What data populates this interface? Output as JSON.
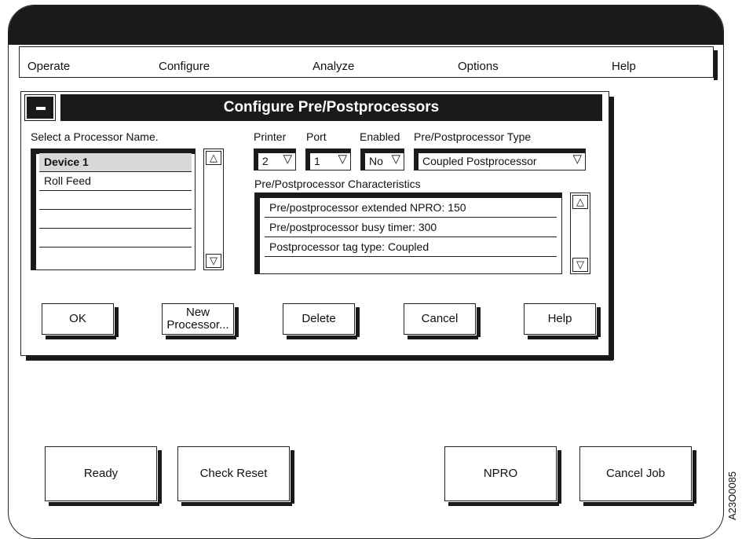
{
  "menubar": {
    "items": [
      "Operate",
      "Configure",
      "Analyze",
      "Options",
      "Help"
    ]
  },
  "dialog": {
    "title": "Configure Pre/Postprocessors",
    "processor_list": {
      "label": "Select a Processor Name.",
      "items": [
        "Device 1",
        "Roll Feed",
        "",
        "",
        "",
        ""
      ],
      "selected": "Device 1"
    },
    "printer": {
      "label": "Printer",
      "value": "2"
    },
    "port": {
      "label": "Port",
      "value": "1"
    },
    "enabled": {
      "label": "Enabled",
      "value": "No"
    },
    "type": {
      "label": "Pre/Postprocessor Type",
      "value": "Coupled Postprocessor"
    },
    "characteristics": {
      "label": "Pre/Postprocessor Characteristics",
      "items": [
        "Pre/postprocessor extended NPRO: 150",
        "Pre/postprocessor busy timer: 300",
        "Postprocessor tag type: Coupled",
        ""
      ]
    },
    "buttons": {
      "ok": "OK",
      "new_processor_line1": "New",
      "new_processor_line2": "Processor...",
      "delete": "Delete",
      "cancel": "Cancel",
      "help": "Help"
    }
  },
  "bottom_buttons": {
    "ready": "Ready",
    "check_reset": "Check Reset",
    "npro": "NPRO",
    "cancel_job": "Cancel Job"
  },
  "figure_id": "A23O0085",
  "icons": {
    "scroll_up": "△",
    "scroll_down": "▽",
    "dropdown": "▽"
  }
}
